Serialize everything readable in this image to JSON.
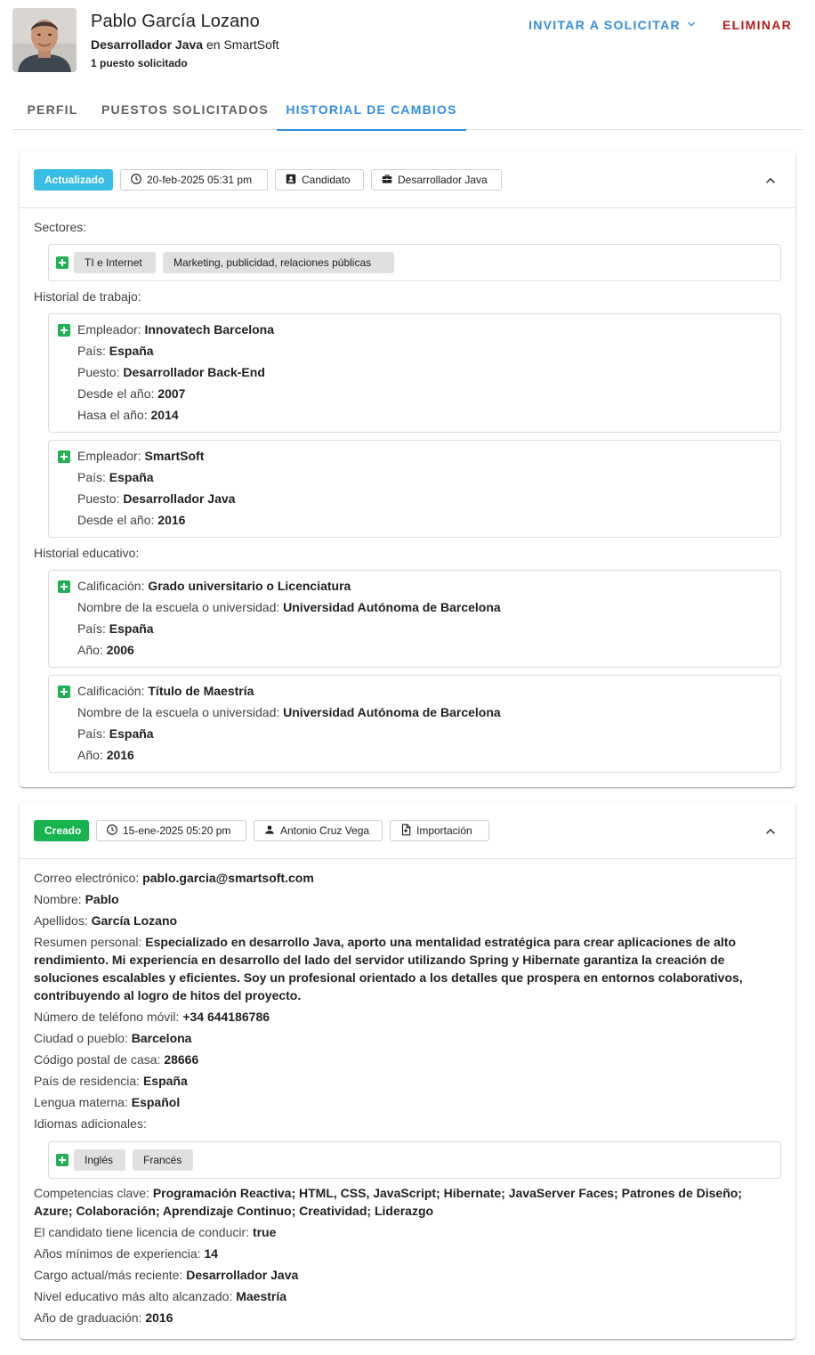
{
  "candidate": {
    "name": "Pablo García Lozano",
    "role": "Desarrollador Java",
    "connector": "en",
    "company": "SmartSoft",
    "applied_count": "1 puesto solicitado"
  },
  "actions": {
    "invite_label": "INVITAR A SOLICITAR",
    "delete_label": "ELIMINAR"
  },
  "tabs": [
    {
      "label": "PERFIL",
      "active": false
    },
    {
      "label": "PUESTOS SOLICITADOS",
      "active": false
    },
    {
      "label": "HISTORIAL DE CAMBIOS",
      "active": true
    }
  ],
  "entries": [
    {
      "status": "Actualizado",
      "status_color": "#38bde6",
      "datetime": "20-feb-2025 05:31 pm",
      "actor": "Candidato",
      "actor_icon": "contact-card-icon",
      "context": "Desarrollador Java",
      "context_icon": "briefcase-icon",
      "sectors_label": "Sectores:",
      "sectors": [
        "TI e Internet",
        "Marketing, publicidad, relaciones públicas"
      ],
      "work_label": "Historial de trabajo:",
      "work": [
        {
          "employer_k": "Empleador:",
          "employer": "Innovatech Barcelona",
          "country_k": "País:",
          "country": "España",
          "position_k": "Puesto:",
          "position": "Desarrollador Back-End",
          "from_k": "Desde el año:",
          "from": "2007",
          "to_k": "Hasa el año:",
          "to": "2014"
        },
        {
          "employer_k": "Empleador:",
          "employer": "SmartSoft",
          "country_k": "País:",
          "country": "España",
          "position_k": "Puesto:",
          "position": "Desarrollador Java",
          "from_k": "Desde el año:",
          "from": "2016"
        }
      ],
      "edu_label": "Historial educativo:",
      "education": [
        {
          "degree_k": "Calificación:",
          "degree": "Grado universitario o Licenciatura",
          "school_k": "Nombre de la escuela o universidad:",
          "school": "Universidad Autónoma de Barcelona",
          "country_k": "País:",
          "country": "España",
          "year_k": "Año:",
          "year": "2006"
        },
        {
          "degree_k": "Calificación:",
          "degree": "Título de Maestría",
          "school_k": "Nombre de la escuela o universidad:",
          "school": "Universidad Autónoma de Barcelona",
          "country_k": "País:",
          "country": "España",
          "year_k": "Año:",
          "year": "2016"
        }
      ]
    },
    {
      "status": "Creado",
      "status_color": "#16b34f",
      "datetime": "15-ene-2025 05:20 pm",
      "actor": "Antonio Cruz Vega",
      "actor_icon": "person-icon",
      "context": "Importación",
      "context_icon": "import-file-icon",
      "fields": {
        "email_k": "Correo electrónico:",
        "email": "pablo.garcia@smartsoft.com",
        "first_name_k": "Nombre:",
        "first_name": "Pablo",
        "last_name_k": "Apellidos:",
        "last_name": "García Lozano",
        "summary_k": "Resumen personal:",
        "summary": "Especializado en desarrollo Java, aporto una mentalidad estratégica para crear aplicaciones de alto rendimiento. Mi experiencia en desarrollo del lado del servidor utilizando Spring y Hibernate garantiza la creación de soluciones escalables y eficientes. Soy un profesional orientado a los detalles que prospera en entornos colaborativos, contribuyendo al logro de hitos del proyecto.",
        "phone_k": "Número de teléfono móvil:",
        "phone": "+34 644186786",
        "city_k": "Ciudad o pueblo:",
        "city": "Barcelona",
        "postal_k": "Código postal de casa:",
        "postal": "28666",
        "residence_k": "País de residencia:",
        "residence": "España",
        "native_k": "Lengua materna:",
        "native": "Español",
        "languages_k": "Idiomas adicionales:",
        "languages": [
          "Inglés",
          "Francés"
        ],
        "skills_k": "Competencias clave:",
        "skills": "Programación Reactiva; HTML, CSS, JavaScript; Hibernate; JavaServer Faces; Patrones de Diseño; Azure; Colaboración; Aprendizaje Continuo; Creatividad; Liderazgo",
        "license_k": "El candidato tiene licencia de conducir:",
        "license": "true",
        "min_exp_k": "Años mínimos de experiencia:",
        "min_exp": "14",
        "current_role_k": "Cargo actual/más reciente:",
        "current_role": "Desarrollador Java",
        "edu_level_k": "Nivel educativo más alto alcanzado:",
        "edu_level": "Maestría",
        "grad_year_k": "Año de graduación:",
        "grad_year": "2016"
      }
    }
  ],
  "colors": {
    "accent": "#2f8de4",
    "danger": "#b71c1c",
    "added": "#1fb152"
  }
}
